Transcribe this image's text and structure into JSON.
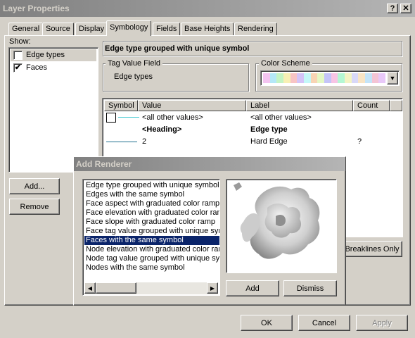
{
  "window": {
    "title": "Layer Properties",
    "help_glyph": "?",
    "close_glyph": "✕"
  },
  "tabs": [
    "General",
    "Source",
    "Display",
    "Symbology",
    "Fields",
    "Base Heights",
    "Rendering"
  ],
  "active_tab": "Symbology",
  "show": {
    "label": "Show:",
    "items": [
      {
        "label": "Edge types",
        "checked": false
      },
      {
        "label": "Faces",
        "checked": true
      }
    ],
    "check_glyph": "✔"
  },
  "sidebar_buttons": {
    "add": "Add...",
    "remove": "Remove"
  },
  "renderer_header": "Edge type grouped with unique symbol",
  "tag_value_field": {
    "legend": "Tag Value Field",
    "value": "Edge types"
  },
  "color_scheme": {
    "legend": "Color Scheme",
    "swatches": [
      "#f4c4f0",
      "#b4e8f8",
      "#c4f4c4",
      "#f8f0b4",
      "#f8c4c4",
      "#d4c4f8",
      "#c4f8f8",
      "#f8d4b4",
      "#e4f8c4",
      "#c4c4f8",
      "#f8c4e4",
      "#b4f8d4",
      "#f4f4c4",
      "#d8d8f8",
      "#f8e4c4",
      "#c4e4f8",
      "#f4c4d4",
      "#e8c8f8"
    ],
    "arrow": "▼"
  },
  "symbol_table": {
    "columns": [
      "Symbol",
      "Value",
      "Label",
      "Count"
    ],
    "rows": [
      {
        "value": "<all other values>",
        "label": "<all other values>",
        "count": ""
      },
      {
        "value": "<Heading>",
        "label": "Edge type",
        "count": "",
        "bold": true
      },
      {
        "value": "2",
        "label": "Hard Edge",
        "count": "?"
      }
    ]
  },
  "breaklines_button": "Breaklines Only",
  "footer": {
    "ok": "OK",
    "cancel": "Cancel",
    "apply": "Apply"
  },
  "add_renderer": {
    "title": "Add Renderer",
    "items": [
      "Edge type grouped with unique symbol",
      "Edges with the same symbol",
      "Face aspect with graduated color ramp",
      "Face elevation with graduated color ramp",
      "Face slope with graduated color ramp",
      "Face tag value grouped with unique symbol",
      "Faces with the same symbol",
      "Node elevation with graduated color ramp",
      "Node tag value grouped with unique symbol",
      "Nodes with the same symbol"
    ],
    "selected_index": 6,
    "add_button": "Add",
    "dismiss_button": "Dismiss",
    "scroll_left": "◀",
    "scroll_right": "▶"
  }
}
